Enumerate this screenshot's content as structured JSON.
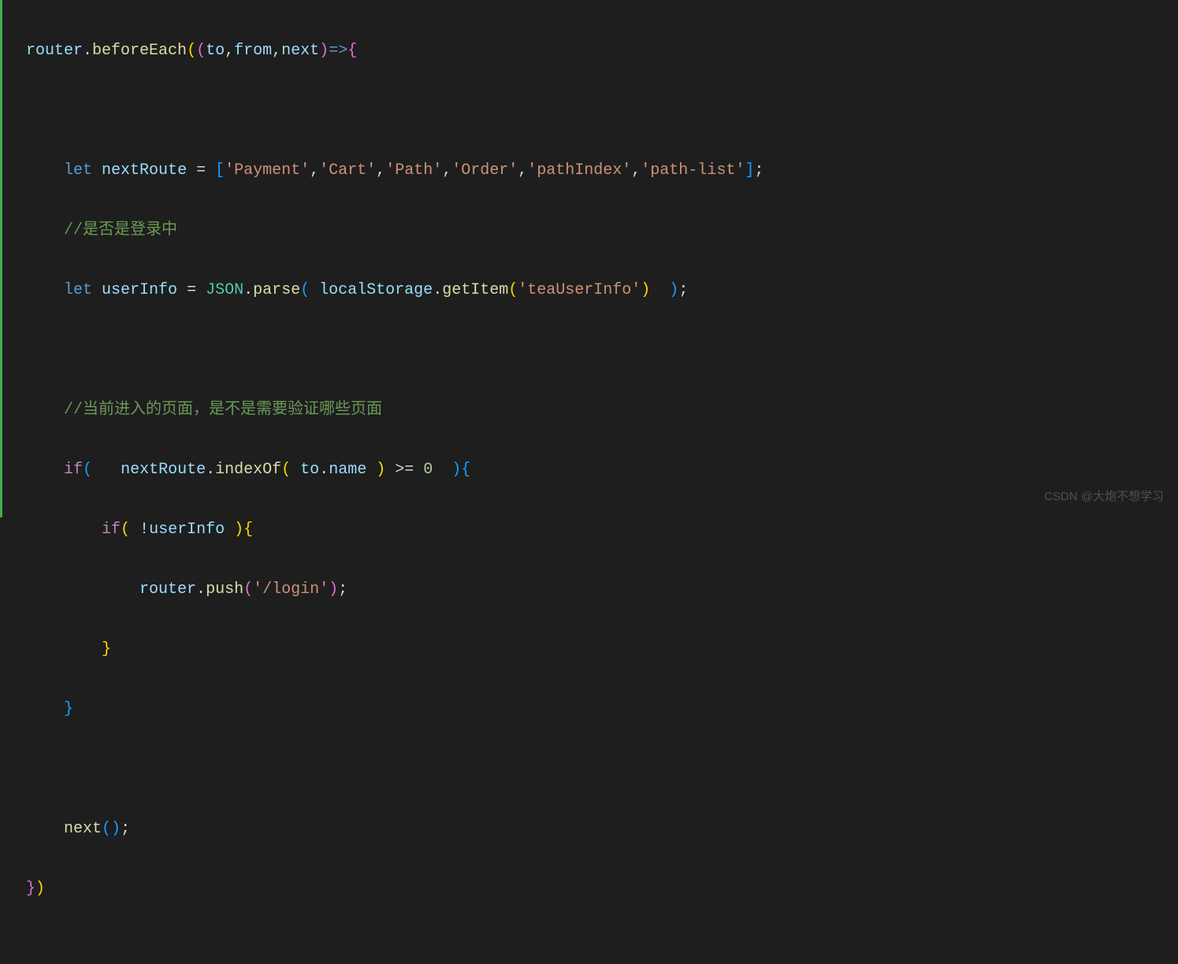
{
  "code": {
    "line1": {
      "router": "router",
      "dot1": ".",
      "beforeEach": "beforeEach",
      "openParen": "(",
      "openParen2": "(",
      "to": "to",
      "comma1": ",",
      "from": "from",
      "comma2": ",",
      "next": "next",
      "closeParen": ")",
      "arrow": "=>",
      "brace": "{"
    },
    "line3": {
      "let": "let",
      "nextRoute": "nextRoute",
      "eq": " = ",
      "openBracket": "[",
      "s1": "'Payment'",
      "c1": ",",
      "s2": "'Cart'",
      "c2": ",",
      "s3": "'Path'",
      "c3": ",",
      "s4": "'Order'",
      "c4": ",",
      "s5": "'pathIndex'",
      "c5": ",",
      "s6": "'path-list'",
      "closeBracket": "]",
      "semi": ";"
    },
    "line4": {
      "comment": "//是否是登录中"
    },
    "line5": {
      "let": "let",
      "userInfo": "userInfo",
      "eq": " = ",
      "JSON": "JSON",
      "dot": ".",
      "parse": "parse",
      "openParen": "(",
      "localStorage": "localStorage",
      "dot2": ".",
      "getItem": "getItem",
      "openParen2": "(",
      "str": "'teaUserInfo'",
      "closeParen2": ")",
      "closeParen": ")",
      "semi": ";"
    },
    "line7": {
      "comment": "//当前进入的页面，是不是需要验证哪些页面"
    },
    "line8": {
      "if": "if",
      "openParen": "(",
      "nextRoute": "nextRoute",
      "dot": ".",
      "indexOf": "indexOf",
      "openParen2": "(",
      "to": "to",
      "dot2": ".",
      "name": "name",
      "closeParen2": ")",
      "gte": " >= ",
      "zero": "0",
      "closeParen": ")",
      "brace": "{"
    },
    "line9": {
      "if": "if",
      "openParen": "(",
      "bang": " !",
      "userInfo": "userInfo",
      "closeParen": ")",
      "brace": "{"
    },
    "line10": {
      "router": "router",
      "dot": ".",
      "push": "push",
      "openParen": "(",
      "str": "'/login'",
      "closeParen": ")",
      "semi": ";"
    },
    "line11": {
      "brace": "}"
    },
    "line12": {
      "brace": "}"
    },
    "line14": {
      "next": "next",
      "openParen": "(",
      "closeParen": ")",
      "semi": ";"
    },
    "line15": {
      "brace": "}",
      "closeParen": ")"
    }
  },
  "watermark": "CSDN @大炮不想学习"
}
